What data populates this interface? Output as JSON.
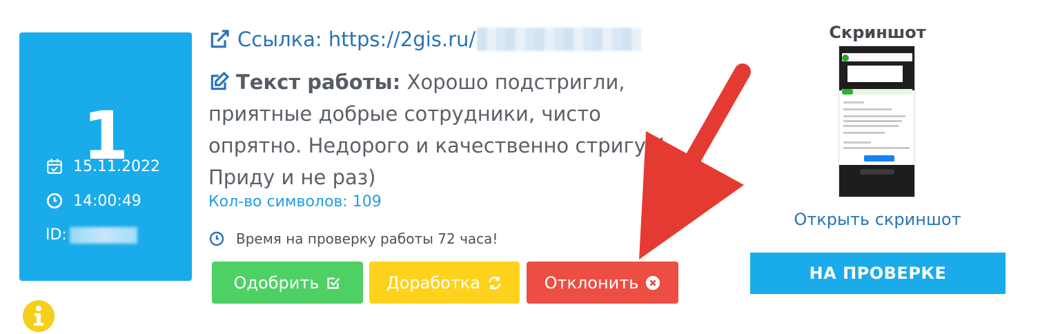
{
  "card": {
    "number": "1",
    "date": "15.11.2022",
    "time": "14:00:49",
    "id_label": "ID:"
  },
  "task": {
    "link_label": "Ссылка:",
    "link_url": "https://2gis.ru/",
    "text_label": "Текст работы:",
    "text_body": "Хорошо подстригли, приятные добрые сотрудники, чисто опрятно. Недорого и качественно стригут! Приду и не раз)",
    "char_count": "Кол-во символов: 109",
    "time_note": "Время на проверку работы 72 часа!"
  },
  "actions": {
    "approve_label": "Одобрить",
    "rework_label": "Доработка",
    "reject_label": "Отклонить"
  },
  "screenshot": {
    "title": "Скриншот",
    "open_label": "Открыть скриншот",
    "status_label": "НА ПРОВЕРКЕ"
  },
  "colors": {
    "card_bg": "#1aabea",
    "approve": "#4fd065",
    "rework": "#fed21c",
    "reject": "#ec4e44",
    "link": "#2873b8",
    "arrow": "#e53a31",
    "info": "#f6cf1c"
  },
  "icons": {
    "date": "calendar-check-icon",
    "time": "clock-icon",
    "link": "external-link-icon",
    "text": "edit-icon",
    "approve": "check-square-icon",
    "rework": "refresh-icon",
    "reject": "times-circle-icon",
    "info": "info-circle-icon"
  }
}
